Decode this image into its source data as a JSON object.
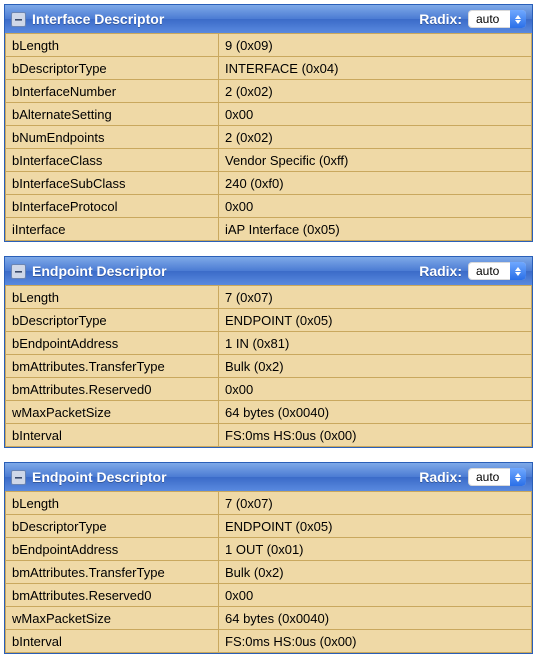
{
  "radix_label": "Radix:",
  "radix_value": "auto",
  "panels": [
    {
      "title": "Interface Descriptor",
      "rows": [
        {
          "key": "bLength",
          "value": "9 (0x09)"
        },
        {
          "key": "bDescriptorType",
          "value": "INTERFACE (0x04)"
        },
        {
          "key": "bInterfaceNumber",
          "value": "2 (0x02)"
        },
        {
          "key": "bAlternateSetting",
          "value": "0x00"
        },
        {
          "key": "bNumEndpoints",
          "value": "2 (0x02)"
        },
        {
          "key": "bInterfaceClass",
          "value": "Vendor Specific (0xff)"
        },
        {
          "key": "bInterfaceSubClass",
          "value": "240 (0xf0)"
        },
        {
          "key": "bInterfaceProtocol",
          "value": "0x00"
        },
        {
          "key": "iInterface",
          "value": "iAP Interface (0x05)"
        }
      ]
    },
    {
      "title": "Endpoint Descriptor",
      "rows": [
        {
          "key": "bLength",
          "value": "7 (0x07)"
        },
        {
          "key": "bDescriptorType",
          "value": "ENDPOINT (0x05)"
        },
        {
          "key": "bEndpointAddress",
          "value": "1 IN (0x81)"
        },
        {
          "key": "bmAttributes.TransferType",
          "value": "Bulk (0x2)"
        },
        {
          "key": "bmAttributes.Reserved0",
          "value": "0x00"
        },
        {
          "key": "wMaxPacketSize",
          "value": "64 bytes (0x0040)"
        },
        {
          "key": "bInterval",
          "value": "FS:0ms HS:0us (0x00)"
        }
      ]
    },
    {
      "title": "Endpoint Descriptor",
      "rows": [
        {
          "key": "bLength",
          "value": "7 (0x07)"
        },
        {
          "key": "bDescriptorType",
          "value": "ENDPOINT (0x05)"
        },
        {
          "key": "bEndpointAddress",
          "value": "1 OUT (0x01)"
        },
        {
          "key": "bmAttributes.TransferType",
          "value": "Bulk (0x2)"
        },
        {
          "key": "bmAttributes.Reserved0",
          "value": "0x00"
        },
        {
          "key": "wMaxPacketSize",
          "value": "64 bytes (0x0040)"
        },
        {
          "key": "bInterval",
          "value": "FS:0ms HS:0us (0x00)"
        }
      ]
    }
  ]
}
